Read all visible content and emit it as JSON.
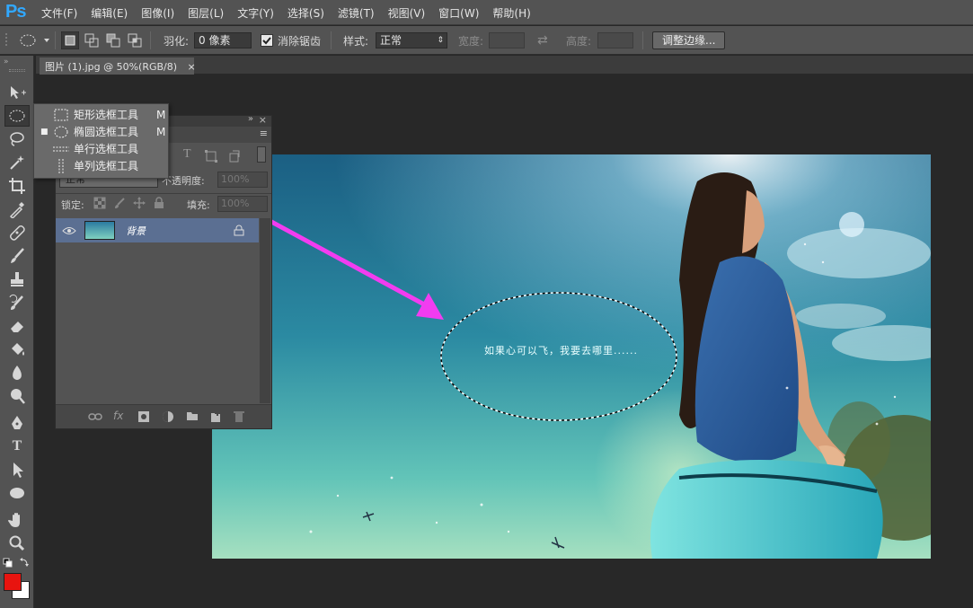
{
  "app": {
    "logo": "Ps"
  },
  "menu": [
    "文件(F)",
    "编辑(E)",
    "图像(I)",
    "图层(L)",
    "文字(Y)",
    "选择(S)",
    "滤镜(T)",
    "视图(V)",
    "窗口(W)",
    "帮助(H)"
  ],
  "options": {
    "feather_label": "羽化:",
    "feather_value": "0 像素",
    "antialias_label": "消除锯齿",
    "antialias_checked": true,
    "style_label": "样式:",
    "style_value": "正常",
    "width_label": "宽度:",
    "height_label": "高度:",
    "refine_button": "调整边缘..."
  },
  "document": {
    "tab_title": "图片 (1).jpg @ 50%(RGB/8)",
    "close": "×"
  },
  "flyout": [
    {
      "label": "矩形选框工具",
      "shortcut": "M",
      "icon": "rect-marquee-icon"
    },
    {
      "label": "椭圆选框工具",
      "shortcut": "M",
      "icon": "ellipse-marquee-icon",
      "active": true
    },
    {
      "label": "单行选框工具",
      "shortcut": "",
      "icon": "single-row-marquee-icon"
    },
    {
      "label": "单列选框工具",
      "shortcut": "",
      "icon": "single-column-marquee-icon"
    }
  ],
  "layers": {
    "blend_mode": "正常",
    "opacity_label": "不透明度:",
    "opacity_value": "100%",
    "lock_label": "锁定:",
    "fill_label": "填充:",
    "fill_value": "100%",
    "layer_name": "背景",
    "collapse": "»",
    "close": "×"
  },
  "canvas": {
    "caption": "如果心可以飞，我要去哪里......"
  },
  "colors": {
    "foreground": "#e8140f",
    "background": "#ffffff",
    "arrow": "#f23cf0"
  }
}
